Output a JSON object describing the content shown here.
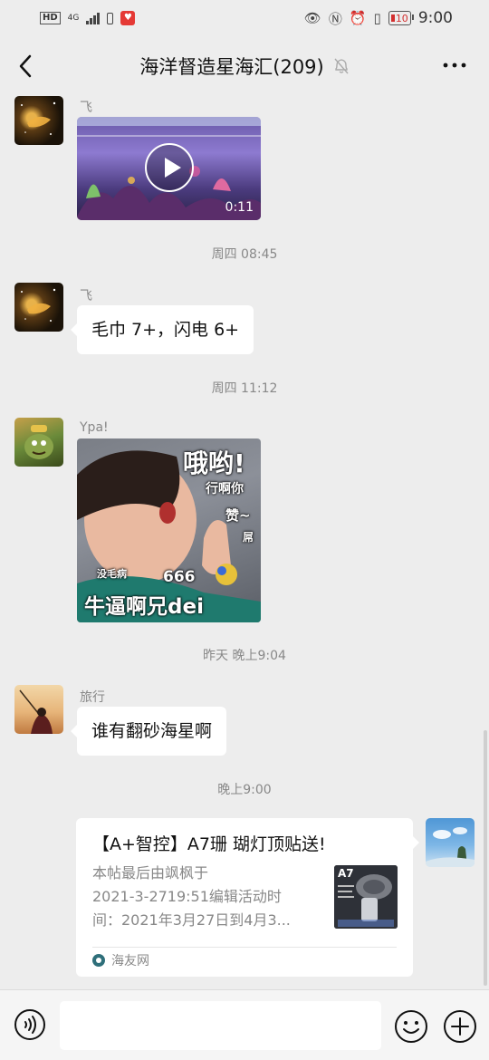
{
  "status_bar": {
    "hd": "HD",
    "network": "4G",
    "battery_level": "10",
    "time": "9:00"
  },
  "header": {
    "title": "海洋督造星海汇(209)",
    "icons": [
      "back-icon",
      "mute-bell-icon",
      "more-icon"
    ]
  },
  "messages": [
    {
      "type": "video",
      "sender": "飞",
      "duration": "0:11"
    },
    {
      "type": "timestamp",
      "text": "周四 08:45"
    },
    {
      "type": "text",
      "sender": "飞",
      "text": "毛巾 7+，闪电 6+"
    },
    {
      "type": "timestamp",
      "text": "周四 11:12"
    },
    {
      "type": "sticker",
      "sender": "Ypa!",
      "caption": {
        "top": "哦哟!",
        "line1": "行啊你",
        "line2": "赞~",
        "line3": "屌",
        "small": "没毛病",
        "number": "666",
        "bottom": "牛逼啊兄dei"
      }
    },
    {
      "type": "timestamp",
      "text": "昨天 晚上9:04"
    },
    {
      "type": "text",
      "sender": "旅行",
      "text": "谁有翻砂海星啊"
    },
    {
      "type": "timestamp",
      "text": "晚上9:00"
    },
    {
      "type": "link",
      "title": "【A+智控】A7珊 瑚灯顶贴送!",
      "description_lines": [
        "本帖最后由飒枫于",
        "2021-3-2719:51编辑活动时",
        "间：2021年3月27日到4月3..."
      ],
      "thumb_label": "A7",
      "source": "海友网"
    }
  ],
  "input_bar": {
    "icons": [
      "voice-icon",
      "emoji-icon",
      "plus-icon"
    ]
  }
}
